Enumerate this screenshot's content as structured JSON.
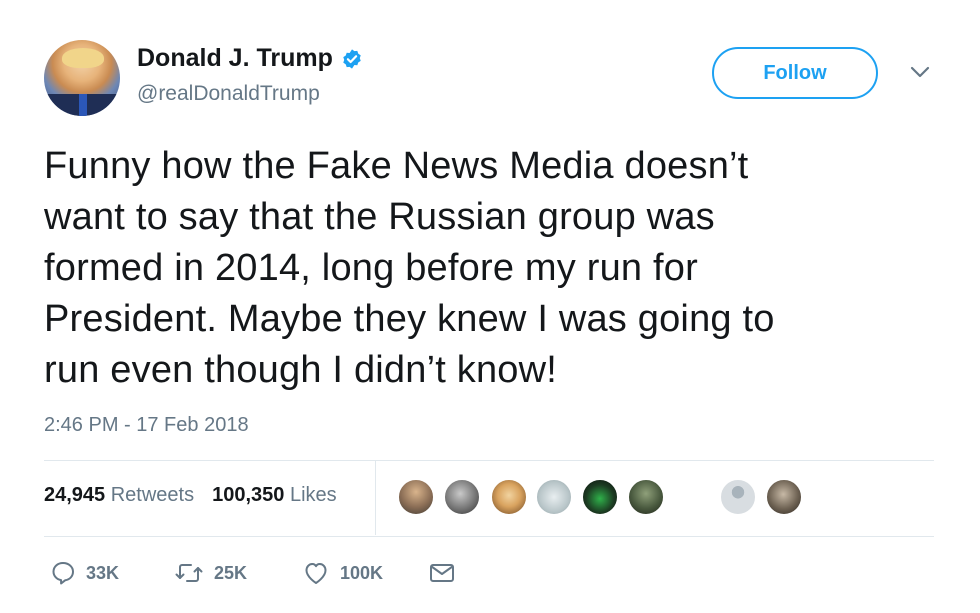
{
  "user": {
    "name": "Donald J. Trump",
    "handle": "@realDonaldTrump",
    "verified_icon": "verified-badge-icon",
    "avatar_icon": "avatar"
  },
  "follow_label": "Follow",
  "menu_icon": "chevron-down-icon",
  "tweet_text": "Funny how the Fake News Media doesn’t\nwant to say that the Russian group was\nformed in 2014, long before my run for\nPresident. Maybe they knew I was going to\nrun even though I didn’t know!",
  "timestamp": "2:46 PM - 17 Feb 2018",
  "stats": {
    "retweets_count": "24,945",
    "retweets_label": "Retweets",
    "likes_count": "100,350",
    "likes_label": "Likes"
  },
  "actions": {
    "reply_count": "33K",
    "retweet_count": "25K",
    "like_count": "100K"
  },
  "colors": {
    "accent": "#1da1f2",
    "text": "#14171a",
    "muted": "#657786",
    "divider": "#e1e8ed"
  }
}
